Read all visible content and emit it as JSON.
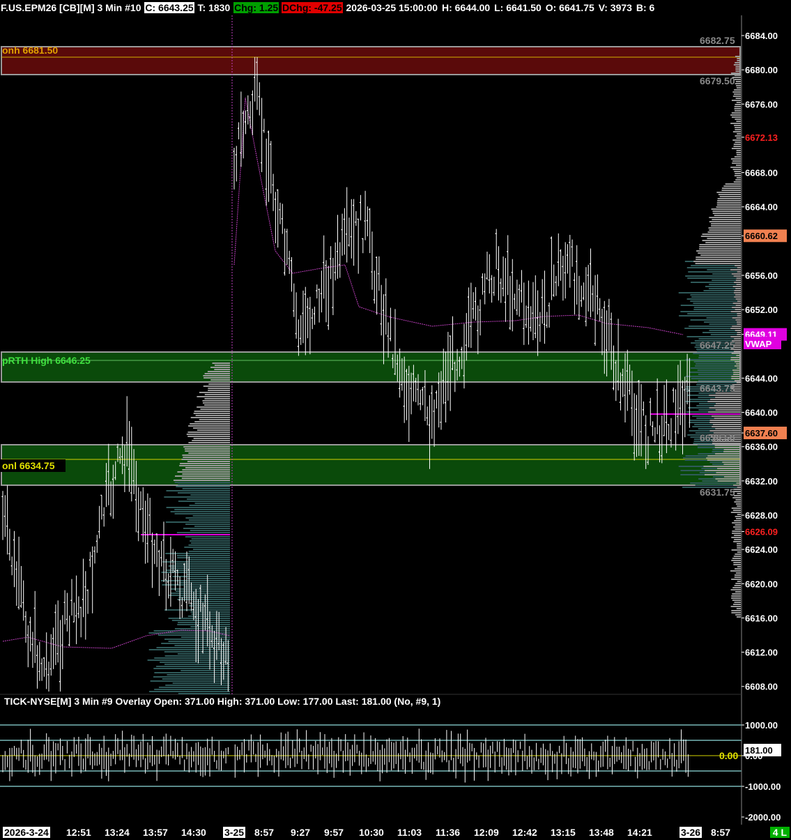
{
  "header": {
    "symbol": "F.US.EPM26 [CB][M]  3 Min  #10",
    "close": "C: 6643.25",
    "trades": "T: 1830",
    "change": "Chg: 1.25",
    "daily_change": "DChg: -47.25",
    "datetime": "2026-03-25 15:00:00",
    "high": "H: 6644.00",
    "low": "L: 6641.50",
    "open": "O: 6641.75",
    "volume": "V: 3973",
    "bid": "B: 6"
  },
  "zones": {
    "onh_label": "onh  6681.50",
    "prth_label": "pRTH High  6646.25",
    "onl_label": "onl  6634.75",
    "zone_top_upper": "6682.75",
    "zone_top_lower": "6679.50",
    "zone_mid_upper": "6647.25",
    "zone_mid_lower": "6643.75",
    "zone_low_upper": "6636.50",
    "zone_low_lower": "6631.75"
  },
  "price_axis": {
    "ticks": [
      "6684.00",
      "6680.00",
      "6676.00",
      "6672.13",
      "6668.00",
      "6664.00",
      "6660.62",
      "6656.00",
      "6652.00",
      "6649.11",
      "6644.00",
      "6640.00",
      "6637.60",
      "6636.00",
      "6632.00",
      "6628.00",
      "6626.09",
      "6624.00",
      "6620.00",
      "6616.00",
      "6612.00",
      "6608.00"
    ],
    "vwap_label": "VWAP",
    "red_levels": [
      "6672.13",
      "6626.09"
    ],
    "orange_levels": [
      "6660.62",
      "6637.60"
    ],
    "magenta_level": "6649.11"
  },
  "subgraph": {
    "title": "TICK-NYSE[M]  3 Min  #9 Overlay  Open: 371.00  High: 371.00  Low: 177.00  Last: 181.00  (No, #9, 1)",
    "axis_ticks": [
      "1000.00",
      "0.00",
      "-1000.00",
      "-2000.00"
    ],
    "last_value": "181.00",
    "zero_label": "0.00"
  },
  "x_axis": {
    "labels": [
      "2026-3-24",
      "12:51",
      "13:24",
      "13:57",
      "14:30",
      "3-25",
      "8:57",
      "9:27",
      "9:57",
      "10:30",
      "11:03",
      "11:36",
      "12:09",
      "12:42",
      "13:15",
      "13:48",
      "14:21",
      "3-26",
      "8:57"
    ],
    "bars_indicator": "4 L"
  },
  "colors": {
    "background": "#000000",
    "bar": "#ffffff",
    "zone_red": "#5a0a0a",
    "zone_green": "#0a4a0a",
    "zone_border": "#9a9a9a",
    "profile_teal": "#2f5a5a",
    "profile_gray": "#9a9a9a",
    "vwap": "#c040c0",
    "poc": "#e000e0",
    "tick_line": "#5a8a8a"
  }
}
